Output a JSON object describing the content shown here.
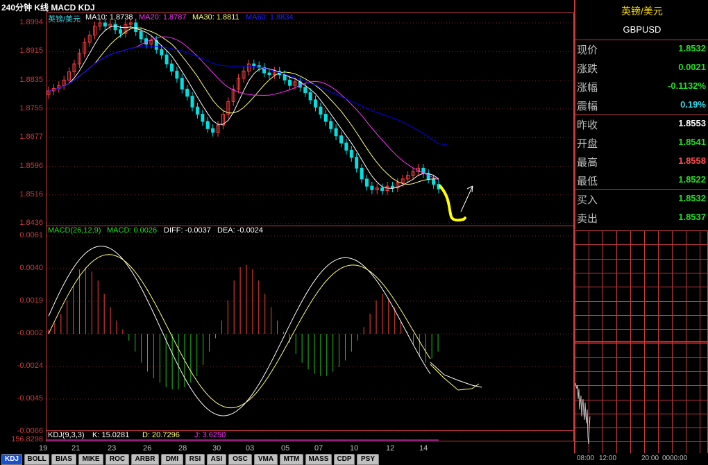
{
  "header": {
    "title": "240分钟 K线 MACD KDJ"
  },
  "main_legend": {
    "symbol": "英镑/美元",
    "ma10": "MA10: 1.8738",
    "ma20": "MA20: 1.8787",
    "ma30": "MA30: 1.8811",
    "ma60": "MA60: 1.8834"
  },
  "price_axis": [
    "1.8994",
    "1.8915",
    "1.8835",
    "1.8755",
    "1.8677",
    "1.8596",
    "1.8516",
    "1.8436"
  ],
  "macd_legend": {
    "name": "MACD(26,12,9)",
    "macd": "MACD: 0.0026",
    "diff": "DIFF: -0.0037",
    "dea": "DEA: -0.0024"
  },
  "macd_axis": [
    "0.0061",
    "0.0040",
    "0.0019",
    "-0.0002",
    "-0.0024",
    "-0.0045",
    "-0.0066"
  ],
  "kdj_legend": {
    "name": "KDJ(9,3,3)",
    "k": "K: 15.0281",
    "d": "D: 20.7296",
    "j": "J: 3.6250"
  },
  "kdj_axis": "156.8298",
  "x_axis": [
    "19",
    "21",
    "23",
    "26",
    "28",
    "30",
    "03",
    "05",
    "07",
    "10",
    "12",
    "14"
  ],
  "quote": {
    "name": "英镑/美元",
    "code": "GBPUSD",
    "rows": [
      {
        "label": "现价",
        "value": "1.8532",
        "color": "#22e022"
      },
      {
        "label": "涨跌",
        "value": "0.0021",
        "color": "#22e022"
      },
      {
        "label": "涨幅",
        "value": "-0.1132%",
        "color": "#22e022"
      },
      {
        "label": "震幅",
        "value": "0.19%",
        "color": "#38d8e8"
      },
      {
        "label": "昨收",
        "value": "1.8553",
        "color": "#ffffff"
      },
      {
        "label": "开盘",
        "value": "1.8541",
        "color": "#22e022"
      },
      {
        "label": "最高",
        "value": "1.8558",
        "color": "#ff5050"
      },
      {
        "label": "最低",
        "value": "1.8522",
        "color": "#22e022"
      },
      {
        "label": "买入",
        "value": "1.8532",
        "color": "#22e022"
      },
      {
        "label": "卖出",
        "value": "1.8537",
        "color": "#22e022"
      }
    ]
  },
  "intraday_axis": {
    "left": "08:00",
    "mid": "12:00",
    "right": "20:00",
    "tail": "0000:00"
  },
  "tabs": [
    "KDJ",
    "BOLL",
    "BIAS",
    "MIKE",
    "ROC",
    "ARBR",
    "DMI",
    "RSI",
    "ASI",
    "OSC",
    "VMA",
    "MTM",
    "MASS",
    "CDP",
    "PSY"
  ],
  "colors": {
    "up": "#ff4040",
    "down": "#00e0e0",
    "ma10": "#ffffff",
    "ma20": "#ff30ff",
    "ma30": "#ffff80",
    "ma60": "#0000ff",
    "grid": "#c83c3c",
    "annotation": "#ffff00"
  }
}
